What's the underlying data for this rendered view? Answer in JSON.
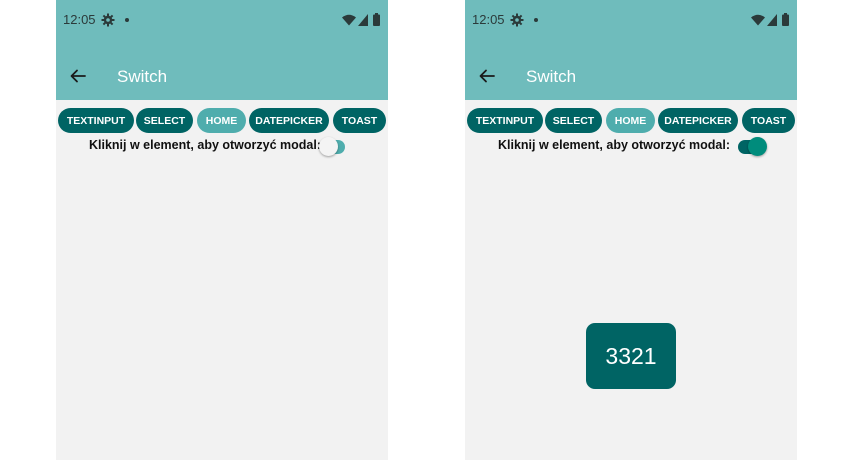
{
  "status": {
    "time": "12:05"
  },
  "appbar": {
    "title": "Switch"
  },
  "tabs": [
    {
      "label": "TEXTINPUT"
    },
    {
      "label": "SELECT"
    },
    {
      "label": "HOME"
    },
    {
      "label": "DATEPICKER"
    },
    {
      "label": "TOAST"
    }
  ],
  "switch": {
    "label": "Kliknij w element, aby otworzyć modal:"
  },
  "screens": {
    "left": {
      "switch_on": false
    },
    "right": {
      "switch_on": true,
      "modal_value": "3321"
    }
  },
  "colors": {
    "appbar": "#6fbcbc",
    "chip": "#006464",
    "chip_active": "#4fadad",
    "background": "#f2f2f2",
    "modal": "#006464"
  },
  "icons": [
    "gear-icon",
    "wifi-icon",
    "signal-icon",
    "battery-icon",
    "back-arrow-icon"
  ]
}
